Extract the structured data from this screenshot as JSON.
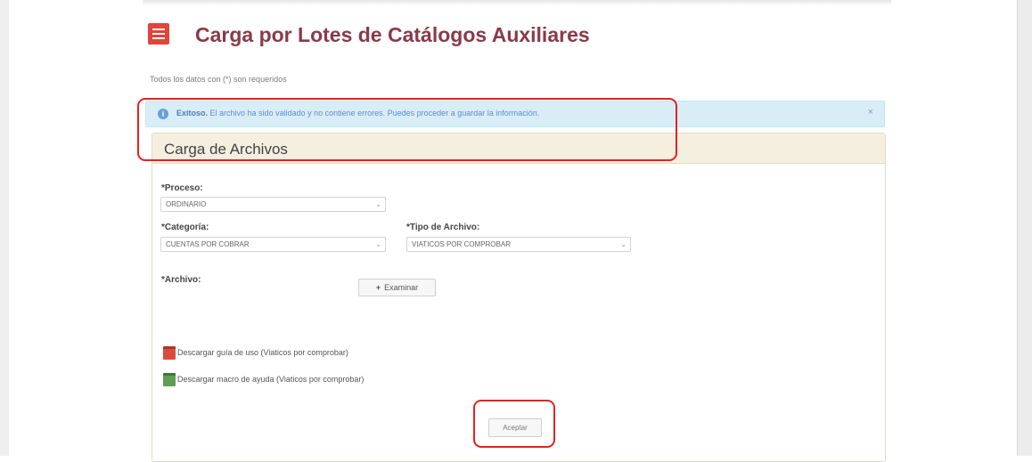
{
  "header": {
    "title": "Carga por Lotes de Catálogos Auxiliares",
    "required_note": "Todos los datos con (*) son requeridos"
  },
  "alert": {
    "strong": "Exitoso.",
    "message": "El archivo ha sido validado y no contiene errores. Puedes proceder a guardar la información.",
    "close": "×"
  },
  "panel": {
    "title": "Carga de Archivos"
  },
  "form": {
    "proceso_label": "*Proceso:",
    "proceso_value": "ORDINARIO",
    "categoria_label": "*Categoría:",
    "categoria_value": "CUENTAS POR COBRAR",
    "tipo_label": "*Tipo de Archivo:",
    "tipo_value": "VIATICOS POR COMPROBAR",
    "archivo_label": "*Archivo:",
    "browse_label": "Examinar",
    "browse_icon": "+"
  },
  "links": {
    "guide": "Descargar guía de uso (Viaticos por comprobar)",
    "macro": "Descargar macro de ayuda (Viaticos por comprobar)"
  },
  "actions": {
    "accept": "Aceptar"
  },
  "colors": {
    "title": "#8a3a48",
    "title_icon": "#e0443a",
    "alert_bg": "#d9edf7",
    "panel_header_bg": "#f5efdf",
    "highlight": "#e8201f"
  }
}
